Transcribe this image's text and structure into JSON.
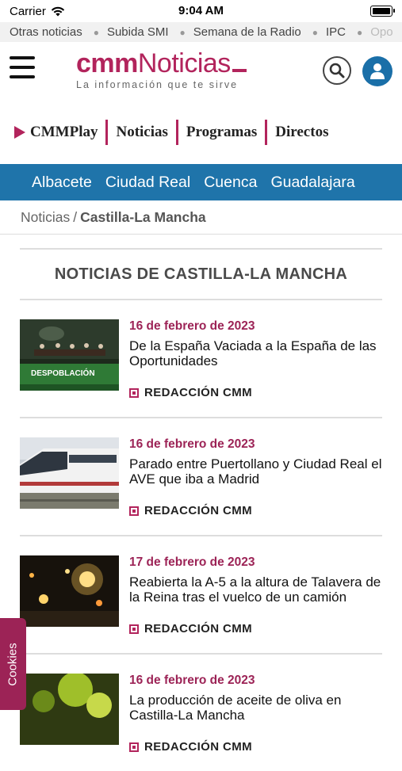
{
  "status": {
    "carrier": "Carrier",
    "time": "9:04 AM"
  },
  "ticker": [
    "Otras noticias",
    "Subida SMI",
    "Semana de la Radio",
    "IPC",
    "Opo"
  ],
  "logo": {
    "cmm": "cmm",
    "noticias": "Noticias",
    "tagline": "La información que te sirve"
  },
  "main_nav": [
    "CMMPlay",
    "Noticias",
    "Programas",
    "Directos"
  ],
  "regions": [
    "Albacete",
    "Ciudad Real",
    "Cuenca",
    "Guadalajara"
  ],
  "breadcrumb": {
    "root": "Noticias",
    "separator": "/",
    "current": "Castilla-La Mancha"
  },
  "section_title": "NOTICIAS DE CASTILLA-LA MANCHA",
  "articles": [
    {
      "date": "16 de febrero de 2023",
      "headline": "De la España Vaciada a la España de las Oportunidades",
      "author": "REDACCIÓN CMM",
      "thumb_text": "DESPOBLACIÓN"
    },
    {
      "date": "16 de febrero de 2023",
      "headline": "Parado entre Puertollano y Ciudad Real el AVE que iba a Madrid",
      "author": "REDACCIÓN CMM"
    },
    {
      "date": "17 de febrero de 2023",
      "headline": "Reabierta la A-5 a la altura de Talavera de la Reina tras el vuelco de un camión",
      "author": "REDACCIÓN CMM"
    },
    {
      "date": "16 de febrero de 2023",
      "headline": "La producción de aceite de oliva en Castilla-La Mancha",
      "author": "REDACCIÓN CMM"
    }
  ],
  "cookies_label": "Cookies",
  "colors": {
    "brand": "#b2245c",
    "date": "#9c2356",
    "region_bar": "#1f74aa",
    "user_button": "#1a6fa8"
  }
}
